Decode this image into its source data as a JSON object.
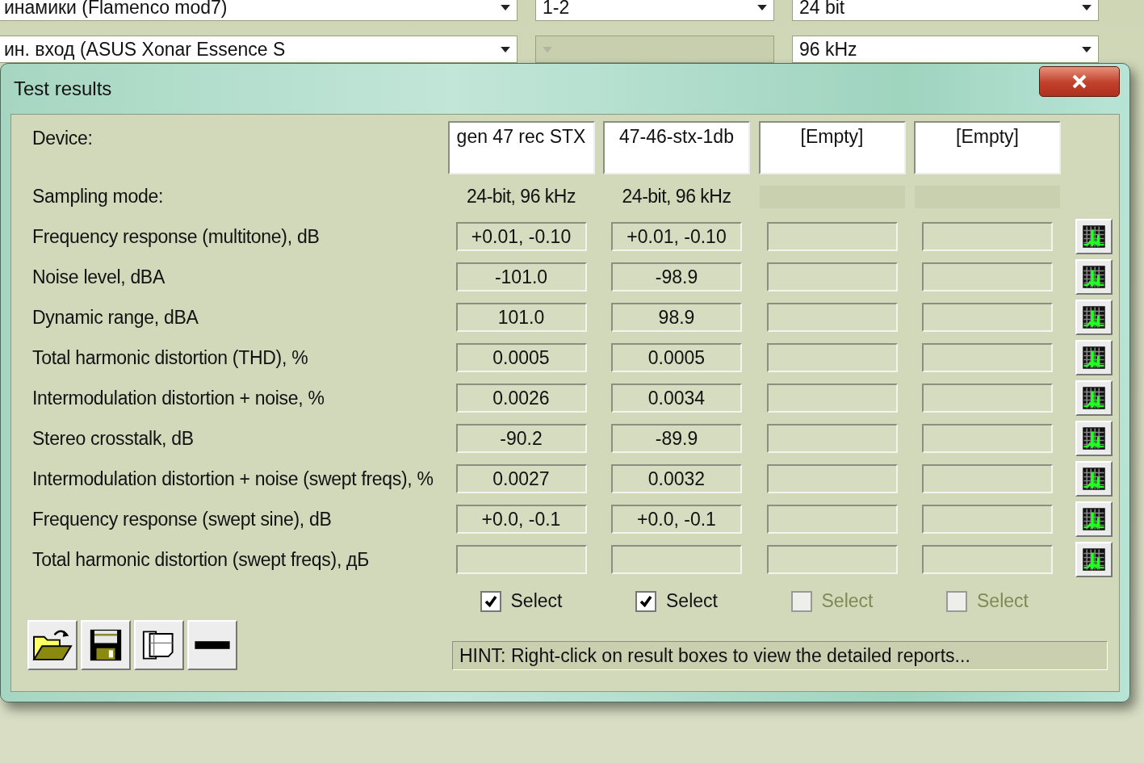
{
  "background": {
    "dropdown_rows": [
      [
        {
          "value": "инамики (Flamenco mod7)",
          "disabled": false
        },
        {
          "value": "1-2",
          "disabled": false
        },
        {
          "value": "24 bit",
          "disabled": false
        }
      ],
      [
        {
          "value": "ин. вход (ASUS Xonar Essence S",
          "disabled": false
        },
        {
          "disabled": true
        },
        {
          "value": "96 kHz",
          "disabled": false
        }
      ]
    ]
  },
  "dialog": {
    "title": "Test results",
    "device_label": "Device:",
    "sampling_label": "Sampling mode:",
    "devices": [
      {
        "name": "gen 47 rec STX",
        "sampling_mode": "24-bit, 96 kHz",
        "select_label": "Select",
        "checked": true,
        "disabled": false
      },
      {
        "name": "47-46-stx-1db",
        "sampling_mode": "24-bit, 96 kHz",
        "select_label": "Select",
        "checked": true,
        "disabled": false
      },
      {
        "name": "[Empty]",
        "select_label": "Select",
        "checked": false,
        "disabled": true
      },
      {
        "name": "[Empty]",
        "select_label": "Select",
        "checked": false,
        "disabled": true
      }
    ],
    "metrics": [
      {
        "label": "Frequency response (multitone), dB",
        "values": [
          "+0.01, -0.10",
          "+0.01, -0.10"
        ]
      },
      {
        "label": "Noise level, dBA",
        "values": [
          "-101.0",
          "-98.9"
        ]
      },
      {
        "label": "Dynamic range, dBA",
        "values": [
          "101.0",
          "98.9"
        ]
      },
      {
        "label": "Total harmonic distortion (THD), %",
        "values": [
          "0.0005",
          "0.0005"
        ]
      },
      {
        "label": "Intermodulation distortion + noise, %",
        "values": [
          "0.0026",
          "0.0034"
        ]
      },
      {
        "label": "Stereo crosstalk, dB",
        "values": [
          "-90.2",
          "-89.9"
        ]
      },
      {
        "label": "Intermodulation distortion + noise (swept freqs), %",
        "values": [
          "0.0027",
          "0.0032"
        ]
      },
      {
        "label": "Frequency response (swept sine), dB",
        "values": [
          "+0.0, -0.1",
          "+0.0, -0.1"
        ]
      },
      {
        "label": "Total harmonic distortion (swept freqs), дБ"
      }
    ],
    "hint": "HINT: Right-click on result boxes to view the detailed reports..."
  }
}
